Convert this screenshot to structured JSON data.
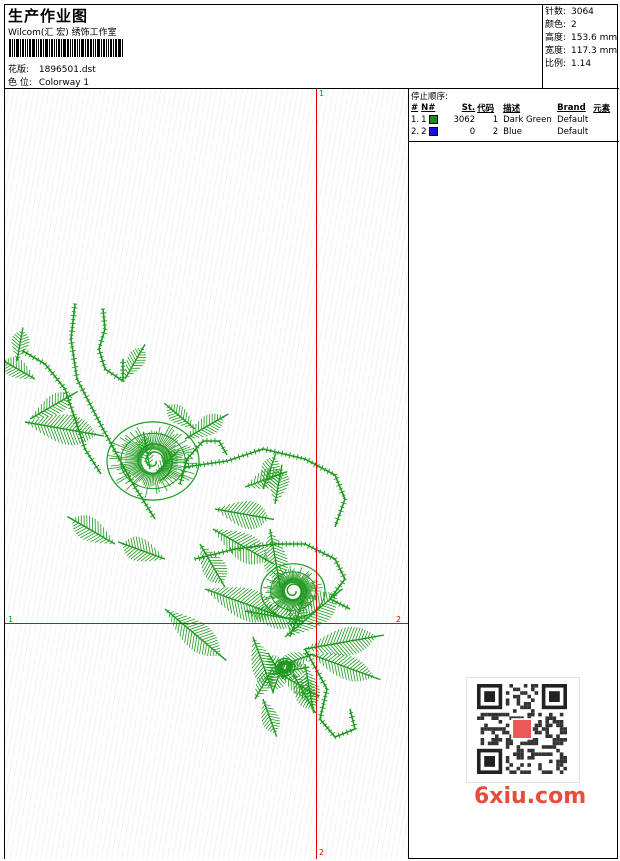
{
  "header": {
    "title": "生产作业图",
    "company": "Wilcom(汇 宏) 绣饰工作室",
    "pattern_label": "花版:",
    "pattern_value": "1896501.dst",
    "colorway_label": "色 位:",
    "colorway_value": "Colorway 1"
  },
  "stats": [
    {
      "label": "针数:",
      "value": "3064"
    },
    {
      "label": "颜色:",
      "value": "2"
    },
    {
      "label": "高度:",
      "value": "153.6 mm"
    },
    {
      "label": "宽度:",
      "value": "117.3 mm"
    },
    {
      "label": "比例:",
      "value": "1.14"
    }
  ],
  "axes": {
    "top": "1",
    "left": "1",
    "right": "2",
    "bottom": "2"
  },
  "sequence": {
    "caption": "停止顺序:",
    "headers": [
      "#",
      "N#",
      "St.",
      "代码",
      "描述",
      "Brand",
      "元素"
    ],
    "rows": [
      {
        "idx": "1.",
        "n": "1",
        "color": "#1a8a1a",
        "stitches": "3062",
        "code": "1",
        "desc": "Dark Green",
        "brand": "Default"
      },
      {
        "idx": "2.",
        "n": "2",
        "color": "#1010e0",
        "stitches": "0",
        "code": "2",
        "desc": "Blue",
        "brand": "Default"
      }
    ]
  },
  "watermark": "6xiu.com",
  "colors": {
    "thread": "#1e9a1e",
    "axis": "#e00000"
  }
}
